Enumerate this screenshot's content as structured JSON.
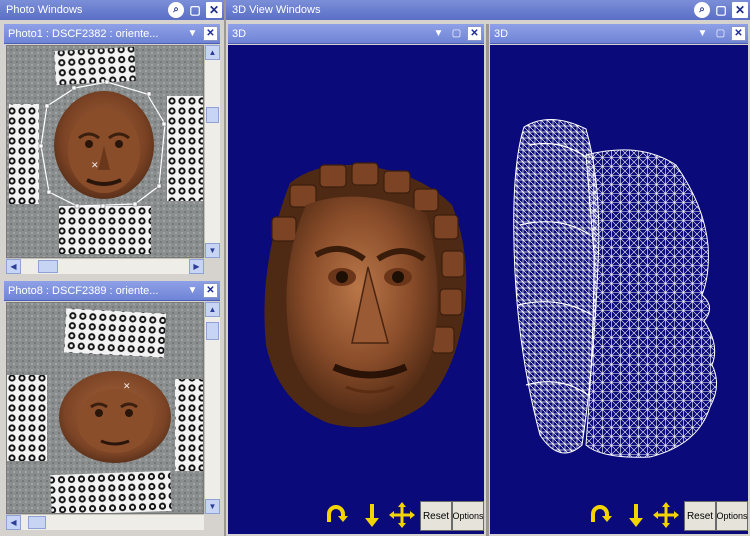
{
  "left_window": {
    "title": "Photo Windows"
  },
  "right_window": {
    "title": "3D View Windows"
  },
  "photo_panes": [
    {
      "title": "Photo1 : DSCF2382 : oriente..."
    },
    {
      "title": "Photo8 : DSCF2389 : oriente..."
    }
  ],
  "view_panes": [
    {
      "title": "3D",
      "reset_label": "Reset",
      "options_label": "Options"
    },
    {
      "title": "3D",
      "reset_label": "Reset",
      "options_label": "Options"
    }
  ],
  "colors": {
    "title_bar": "#5a6ec6",
    "view_bg": "#0a0a7a",
    "control_icon": "#f2d400",
    "mesh": "#ffffff",
    "wood": "#8a4d2a"
  },
  "icons": [
    "pin-icon",
    "restore-icon",
    "close-icon",
    "dropdown-icon",
    "rotate-icon",
    "move-down-icon",
    "pan-icon"
  ]
}
